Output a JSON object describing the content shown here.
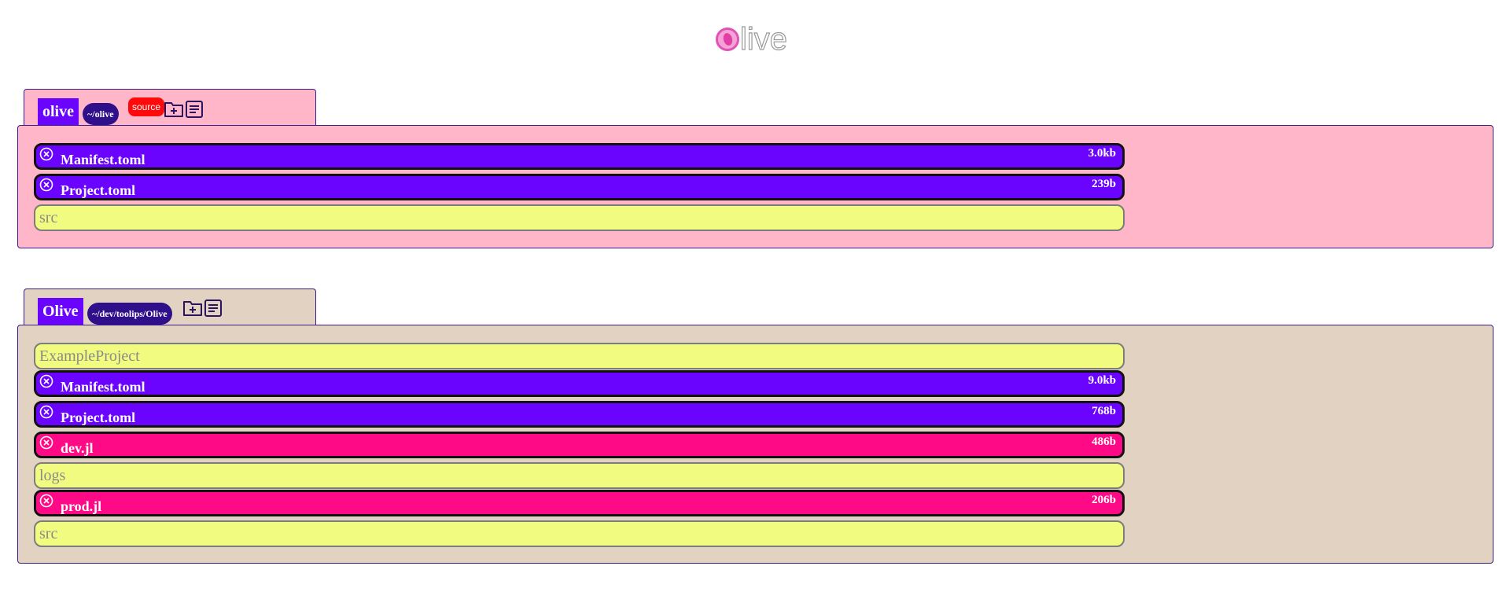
{
  "logo": {
    "text": "live"
  },
  "projects": [
    {
      "name": "olive",
      "path": "~/olive",
      "badge": "source",
      "bg": "#ffb6c8",
      "icons": [
        "new-folder-icon",
        "document-icon"
      ],
      "rows": [
        {
          "type": "file",
          "kind": "toml",
          "name": "Manifest.toml",
          "size": "3.0kb"
        },
        {
          "type": "file",
          "kind": "toml",
          "name": "Project.toml",
          "size": "239b"
        },
        {
          "type": "dir",
          "name": "src"
        }
      ]
    },
    {
      "name": "Olive",
      "path": "~/dev/toolips/Olive",
      "bg": "#e1d2c1",
      "icons": [
        "new-folder-icon",
        "document-icon"
      ],
      "rows": [
        {
          "type": "dir",
          "name": "ExampleProject"
        },
        {
          "type": "file",
          "kind": "toml",
          "name": "Manifest.toml",
          "size": "9.0kb"
        },
        {
          "type": "file",
          "kind": "toml",
          "name": "Project.toml",
          "size": "768b"
        },
        {
          "type": "file",
          "kind": "jl",
          "name": "dev.jl",
          "size": "486b"
        },
        {
          "type": "dir",
          "name": "logs"
        },
        {
          "type": "file",
          "kind": "jl",
          "name": "prod.jl",
          "size": "206b"
        },
        {
          "type": "dir",
          "name": "src"
        }
      ]
    }
  ]
}
